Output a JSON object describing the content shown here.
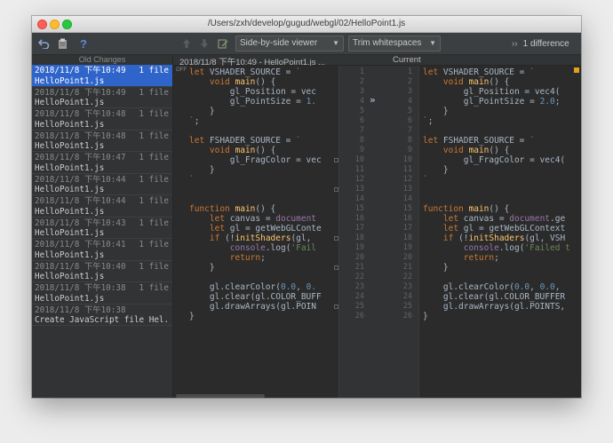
{
  "window": {
    "title": "/Users/zxh/develop/gugud/webgl/02/HelloPoint1.js"
  },
  "toolbar": {
    "viewer_mode": "Side-by-side viewer",
    "whitespace_mode": "Trim whitespaces",
    "diff_count": "1 difference",
    "icons": [
      "revert-icon",
      "clipboard-icon",
      "help-icon",
      "up-arrow-icon",
      "down-arrow-icon",
      "edit-icon"
    ]
  },
  "sidebar": {
    "header": "Old Changes",
    "items": [
      {
        "timestamp": "2018/11/8 下午10:49",
        "count": "1 file",
        "file": "HelloPoint1.js",
        "selected": true
      },
      {
        "timestamp": "2018/11/8 下午10:49",
        "count": "1 file",
        "file": "HelloPoint1.js"
      },
      {
        "timestamp": "2018/11/8 下午10:48",
        "count": "1 file",
        "file": "HelloPoint1.js"
      },
      {
        "timestamp": "2018/11/8 下午10:48",
        "count": "1 file",
        "file": "HelloPoint1.js"
      },
      {
        "timestamp": "2018/11/8 下午10:47",
        "count": "1 file",
        "file": "HelloPoint1.js"
      },
      {
        "timestamp": "2018/11/8 下午10:44",
        "count": "1 file",
        "file": "HelloPoint1.js"
      },
      {
        "timestamp": "2018/11/8 下午10:44",
        "count": "1 file",
        "file": "HelloPoint1.js"
      },
      {
        "timestamp": "2018/11/8 下午10:43",
        "count": "1 file",
        "file": "HelloPoint1.js"
      },
      {
        "timestamp": "2018/11/8 下午10:41",
        "count": "1 file",
        "file": "HelloPoint1.js"
      },
      {
        "timestamp": "2018/11/8 下午10:40",
        "count": "1 file",
        "file": "HelloPoint1.js"
      },
      {
        "timestamp": "2018/11/8 下午10:38",
        "count": "1 file",
        "file": "HelloPoint1.js"
      },
      {
        "timestamp": "2018/11/8 下午10:38",
        "count": "",
        "file": "Create JavaScript file Hel..."
      }
    ]
  },
  "diff": {
    "left_title": "2018/11/8 下午10:49 - HelloPoint1.js ...",
    "right_title": "Current",
    "off_label": "OFF",
    "left_lines": [
      "let VSHADER_SOURCE = `",
      "    void main() {",
      "        gl_Position = vec",
      "        gl_PointSize = 1.",
      "    }",
      "`;",
      "",
      "let FSHADER_SOURCE = `",
      "    void main() {",
      "        gl_FragColor = vec",
      "    }",
      "`",
      "",
      "",
      "function main() {",
      "    let canvas = document",
      "    let gl = getWebGLConte",
      "    if (!initShaders(gl, ",
      "        console.log('Fail",
      "        return;",
      "    }",
      "",
      "    gl.clearColor(0.0, 0.",
      "    gl.clear(gl.COLOR_BUFF",
      "    gl.drawArrays(gl.POIN",
      "}"
    ],
    "right_lines": [
      "let VSHADER_SOURCE = `",
      "    void main() {",
      "        gl_Position = vec4(",
      "        gl_PointSize = 2.0;",
      "    }",
      "`;",
      "",
      "let FSHADER_SOURCE = `",
      "    void main() {",
      "        gl_FragColor = vec4(",
      "    }",
      "`",
      "",
      "",
      "function main() {",
      "    let canvas = document.ge",
      "    let gl = getWebGLContext",
      "    if (!initShaders(gl, VSH",
      "        console.log('Failed t",
      "        return;",
      "    }",
      "",
      "    gl.clearColor(0.0, 0.0, ",
      "    gl.clear(gl.COLOR_BUFFER",
      "    gl.drawArrays(gl.POINTS,",
      "}"
    ],
    "line_numbers": [
      "1",
      "2",
      "3",
      "4",
      "5",
      "6",
      "7",
      "8",
      "9",
      "10",
      "11",
      "12",
      "13",
      "14",
      "15",
      "16",
      "17",
      "18",
      "19",
      "20",
      "21",
      "22",
      "23",
      "24",
      "25",
      "26"
    ],
    "apply_arrow": "»"
  }
}
